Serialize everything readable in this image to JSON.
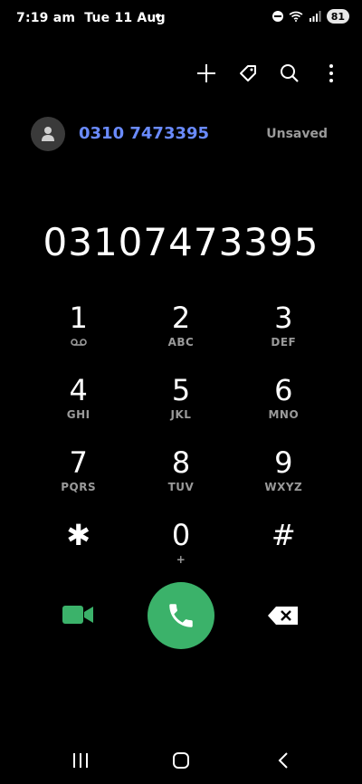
{
  "status_bar": {
    "time": "7:19 am",
    "date": "Tue 11 Aug",
    "dot": "•",
    "battery": "81"
  },
  "toolbar": {
    "icons": [
      "add-icon",
      "tag-icon",
      "search-icon",
      "more-icon"
    ]
  },
  "contact": {
    "number": "0310 7473395",
    "status": "Unsaved"
  },
  "dialed_number": "03107473395",
  "keypad": [
    {
      "digit": "1",
      "letters": ""
    },
    {
      "digit": "2",
      "letters": "ABC"
    },
    {
      "digit": "3",
      "letters": "DEF"
    },
    {
      "digit": "4",
      "letters": "GHI"
    },
    {
      "digit": "5",
      "letters": "JKL"
    },
    {
      "digit": "6",
      "letters": "MNO"
    },
    {
      "digit": "7",
      "letters": "PQRS"
    },
    {
      "digit": "8",
      "letters": "TUV"
    },
    {
      "digit": "9",
      "letters": "WXYZ"
    },
    {
      "digit": "✱",
      "letters": ""
    },
    {
      "digit": "0",
      "letters": "+"
    },
    {
      "digit": "#",
      "letters": ""
    }
  ],
  "colors": {
    "background": "#000000",
    "accent_blue": "#6a8bff",
    "call_green": "#3bb26a",
    "muted_gray": "#9a9a9a"
  }
}
